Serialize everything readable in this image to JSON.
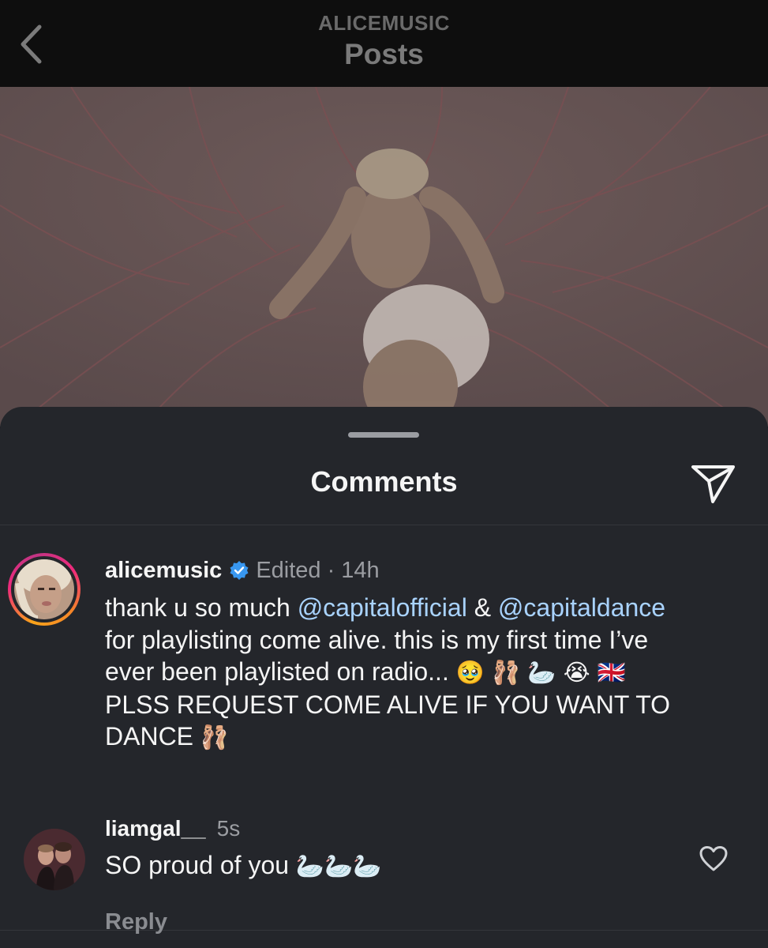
{
  "header": {
    "account": "ALICEMUSIC",
    "title": "Posts",
    "back_icon": "chevron-left-icon"
  },
  "sheet": {
    "title": "Comments",
    "share_icon": "paper-plane-icon"
  },
  "comments": [
    {
      "username": "alicemusic",
      "verified": true,
      "edited": "Edited",
      "separator": "·",
      "time": "14h",
      "text": {
        "l1_pre": "thank u so much ",
        "mention1": "@capitalofficial",
        "l1_mid": " & ",
        "mention2": "@capitaldance",
        "l2": "for playlisting come alive. this is my first time I’ve",
        "l3_text": "ever been playlisted on radio... ",
        "l3_emoji": "🥹 🩰 🦢 😭 🇬🇧",
        "l4": "PLSS REQUEST COME ALIVE IF YOU WANT TO",
        "l5_text": "DANCE ",
        "l5_emoji": "🩰"
      }
    },
    {
      "username": "liamgal__",
      "time": "5s",
      "text": "SO proud of you ",
      "emoji": "🦢🦢🦢",
      "reply": "Reply",
      "like_icon": "heart-outline-icon"
    }
  ],
  "colors": {
    "sheet_bg": "#24262b",
    "mention": "#a9d3ff",
    "muted": "#9b9da2",
    "verified": "#3897f0"
  }
}
